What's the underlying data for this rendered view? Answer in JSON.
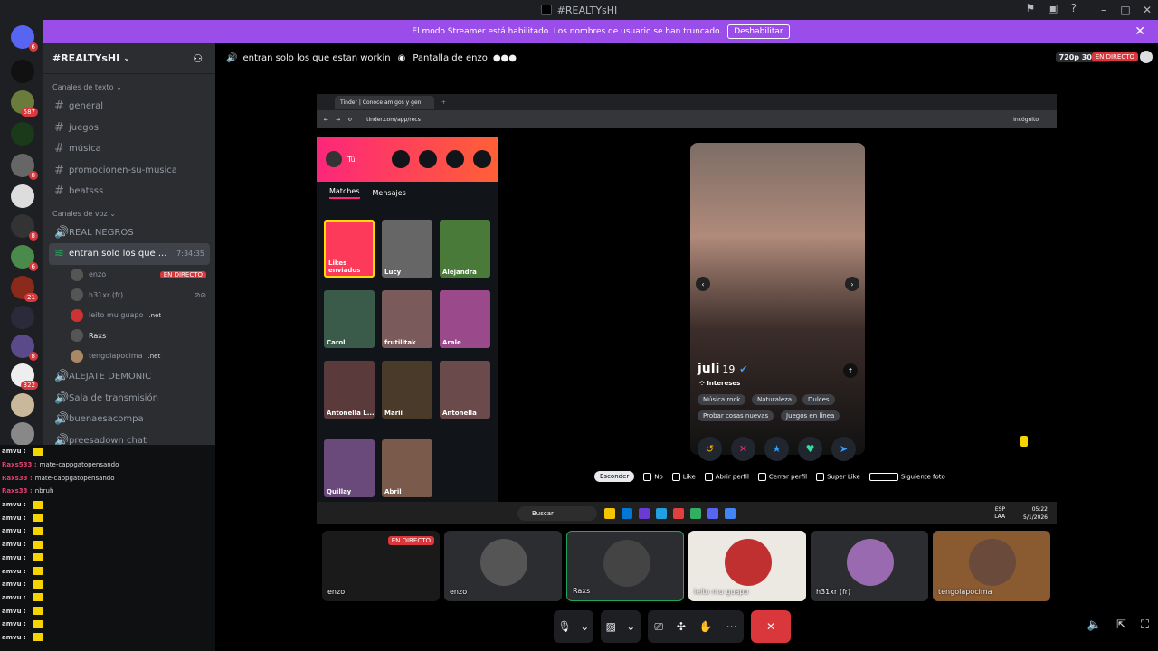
{
  "window": {
    "title": "#REALTYsHI"
  },
  "banner": {
    "text": "El modo Streamer está habilitado. Los nombres de usuario se han truncado.",
    "button": "Deshabilitar"
  },
  "guild_badges": [
    "6",
    "587",
    "8",
    "8",
    "6",
    "21",
    "8",
    "322"
  ],
  "server": {
    "name": "#REALTYsHI"
  },
  "sidebar": {
    "text_category": "Canales de texto",
    "text_channels": [
      "general",
      "juegos",
      "música",
      "promocionen-su-musica",
      "beatsss"
    ],
    "voice_category": "Canales de voz",
    "voice_channels": {
      "first": "REAL NEGROS",
      "active": "entran solo los que ...",
      "active_time": "7:34:35",
      "others": [
        "ALEJATE DEMONIC",
        "Sala de transmisión",
        "buenaesacompa",
        "preesadown chat"
      ]
    },
    "voice_users": [
      {
        "name": "enzo",
        "live": "EN DIRECTO"
      },
      {
        "name": "h31xr (fr)"
      },
      {
        "name": "leito mu guapo",
        "tag": ".net"
      },
      {
        "name": "Raxs"
      },
      {
        "name": "tengolapocima",
        "tag": ".net"
      }
    ]
  },
  "chat": [
    {
      "user": "amvu :",
      "msg": ""
    },
    {
      "user": "Raxs533 :",
      "msg": "mate-cappgatopensando"
    },
    {
      "user": "Raxs33 :",
      "msg": "mate-cappgatopensando"
    },
    {
      "user": "Raxs33 :",
      "msg": "nbruh"
    },
    {
      "user": "amvu :",
      "msg": ""
    },
    {
      "user": "amvu :",
      "msg": ""
    },
    {
      "user": "amvu :",
      "msg": ""
    },
    {
      "user": "amvu :",
      "msg": ""
    },
    {
      "user": "amvu :",
      "msg": ""
    },
    {
      "user": "amvu :",
      "msg": ""
    },
    {
      "user": "amvu :",
      "msg": ""
    },
    {
      "user": "amvu :",
      "msg": ""
    },
    {
      "user": "amvu :",
      "msg": ""
    },
    {
      "user": "amvu :",
      "msg": ""
    },
    {
      "user": "amvu :",
      "msg": ""
    }
  ],
  "stream": {
    "channel": "entran solo los que estan workin",
    "screen_label": "Pantalla de enzo",
    "quality": "720p 30FPS",
    "live": "EN DIRECTO"
  },
  "browser": {
    "tab": "Tinder | Conoce amigos y gen",
    "url": "tinder.com/app/recs",
    "incognito": "Incógnito"
  },
  "tinder": {
    "me": "Tú",
    "tabs": [
      "Matches",
      "Mensajes"
    ],
    "matches": [
      "Likes enviados",
      "Lucy",
      "Alejandra",
      "Carol",
      "frutilitak",
      "Arale",
      "Antonella L...",
      "Marii",
      "Antonella",
      "Quillay",
      "Abril"
    ],
    "profile": {
      "name": "juli",
      "age": "19",
      "interests_label": "Intereses",
      "interests": [
        "Música rock",
        "Naturaleza",
        "Dulces",
        "Probar cosas nuevas",
        "Juegos en línea"
      ]
    },
    "shortcuts": {
      "hide": "Esconder",
      "no": "No",
      "like": "Like",
      "open": "Abrir perfil",
      "close": "Cerrar perfil",
      "super": "Super Like",
      "next": "Siguiente foto"
    }
  },
  "taskbar": {
    "search": "Buscar",
    "lang1": "ESP",
    "lang2": "LAA",
    "time": "05:22",
    "date": "5/1/2026"
  },
  "tiles": [
    {
      "name": "enzo",
      "live": "EN DIRECTO"
    },
    {
      "name": "enzo"
    },
    {
      "name": "Raxs"
    },
    {
      "name": "leito mu guapo"
    },
    {
      "name": "h31xr (fr)"
    },
    {
      "name": "tengolapocima"
    }
  ],
  "colors": {
    "accent": "#9b4dea",
    "danger": "#da373c",
    "tinder": "#fd267a"
  }
}
